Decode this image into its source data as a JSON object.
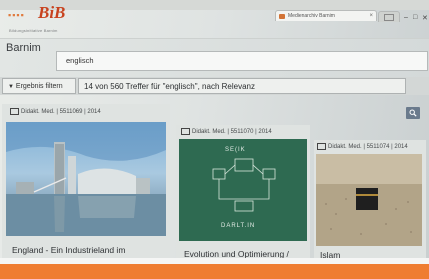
{
  "logo": {
    "dots": "▪▪▪▪",
    "text": "BiB",
    "subtitle": "Bildungsinitiative Barnim"
  },
  "browser_tab": {
    "label": "Medienarchiv Barnim"
  },
  "window": {
    "minimize": "–",
    "maximize": "□",
    "close": "✕"
  },
  "header": {
    "place": "Barnim"
  },
  "search": {
    "value": "englisch"
  },
  "filter": {
    "label": "Ergebnis filtern"
  },
  "results": {
    "summary": "14 von 560 Treffer für \"englisch\", nach Relevanz"
  },
  "cards": [
    {
      "head": "Didakt. Med. | 5511069 | 2014",
      "title": "England - Ein Industrieland im"
    },
    {
      "head": "Didakt. Med. | 5511070 | 2014",
      "title": "Evolution und Optimierung /"
    },
    {
      "head": "Didakt. Med. | 5511074 | 2014",
      "title": "Islam"
    }
  ],
  "card2_board": {
    "line1": "SE(IK",
    "line2": "DARLT.IN"
  },
  "colors": {
    "accent": "#ef7d32",
    "logo": "#c8421e"
  }
}
